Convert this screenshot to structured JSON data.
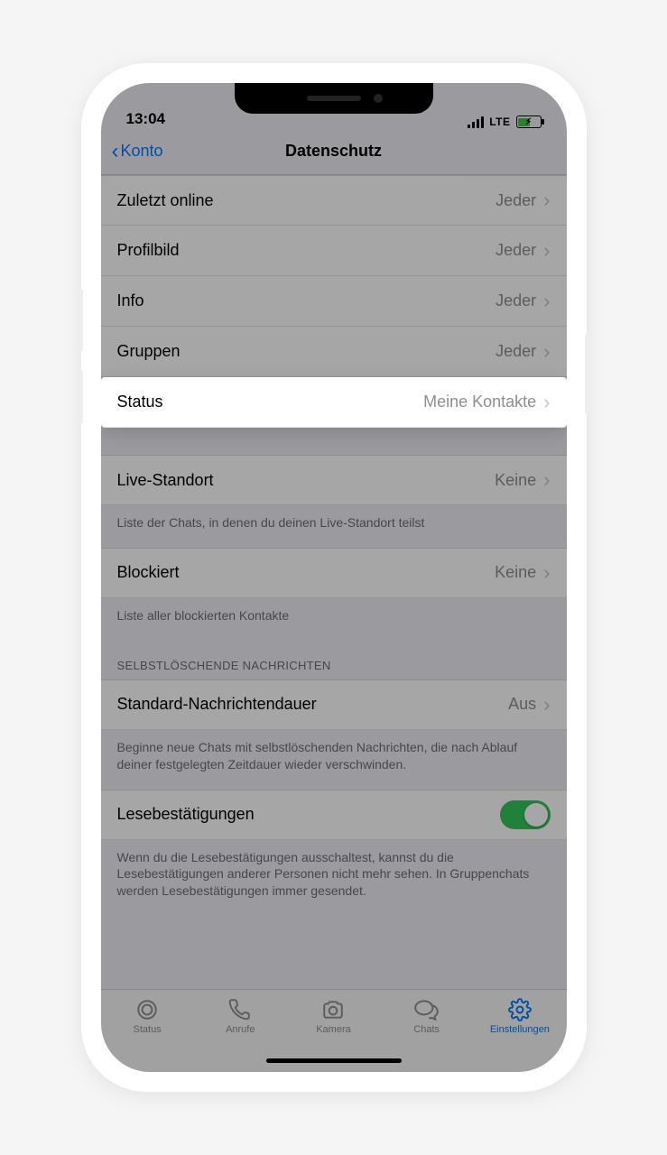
{
  "statusbar": {
    "time": "13:04",
    "network": "LTE"
  },
  "nav": {
    "back": "Konto",
    "title": "Datenschutz"
  },
  "rows": {
    "lastseen": {
      "label": "Zuletzt online",
      "value": "Jeder"
    },
    "photo": {
      "label": "Profilbild",
      "value": "Jeder"
    },
    "about": {
      "label": "Info",
      "value": "Jeder"
    },
    "groups": {
      "label": "Gruppen",
      "value": "Jeder"
    },
    "status": {
      "label": "Status",
      "value": "Meine Kontakte"
    },
    "live": {
      "label": "Live-Standort",
      "value": "Keine"
    },
    "blocked": {
      "label": "Blockiert",
      "value": "Keine"
    },
    "msgtimer": {
      "label": "Standard-Nachrichtendauer",
      "value": "Aus"
    },
    "receipts": {
      "label": "Lesebestätigungen"
    }
  },
  "footers": {
    "live": "Liste der Chats, in denen du deinen Live-Standort teilst",
    "blocked": "Liste aller blockierten Kontakte",
    "msgtimer": "Beginne neue Chats mit selbstlöschenden Nachrichten, die nach Ablauf deiner festgelegten Zeitdauer wieder verschwinden.",
    "receipts": "Wenn du die Lesebestätigungen ausschaltest, kannst du die Lesebestätigungen anderer Personen nicht mehr sehen. In Gruppenchats werden Lesebestätigungen immer gesendet."
  },
  "headers": {
    "disappearing": "SELBSTLÖSCHENDE NACHRICHTEN"
  },
  "tabs": {
    "status": "Status",
    "calls": "Anrufe",
    "camera": "Kamera",
    "chats": "Chats",
    "settings": "Einstellungen"
  }
}
